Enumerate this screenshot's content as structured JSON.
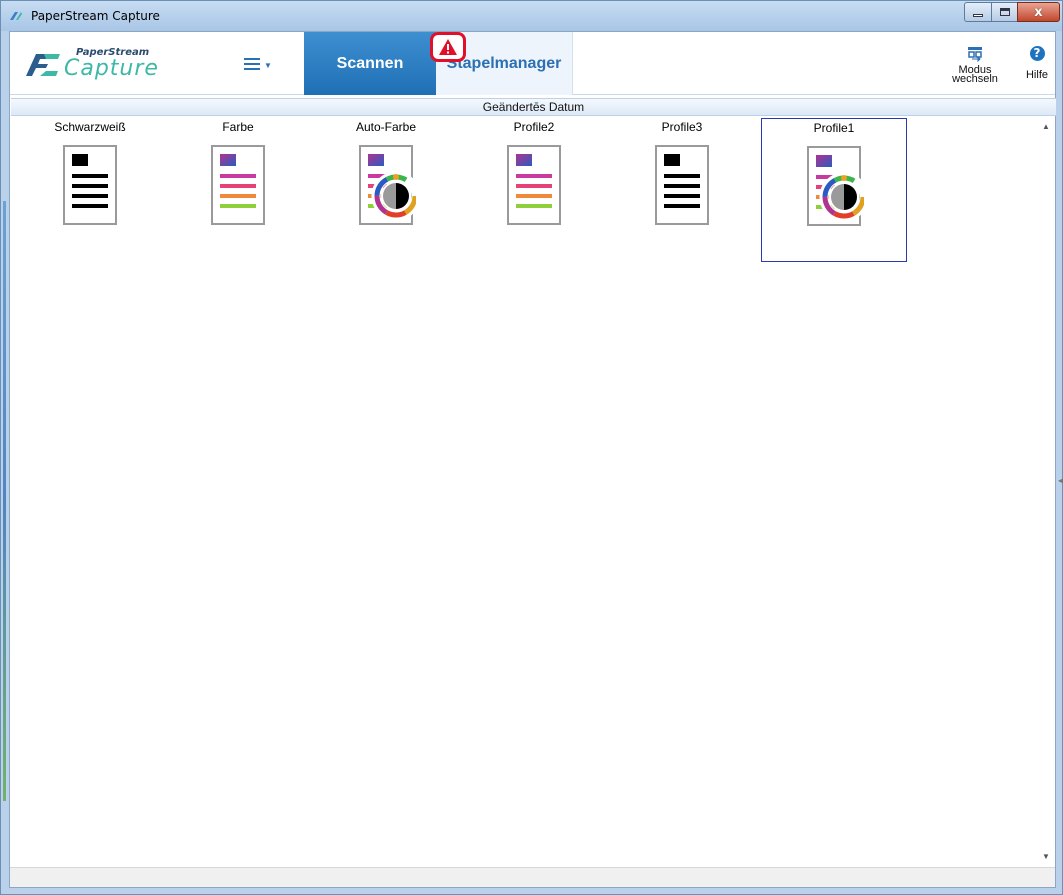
{
  "window": {
    "title": "PaperStream Capture",
    "controls": {
      "minimize": "",
      "maximize": "",
      "close": "x"
    }
  },
  "logo": {
    "small": "PaperStream",
    "big": "Capture"
  },
  "tabs": [
    {
      "label": "Scannen",
      "active": true
    },
    {
      "label": "Stapelmanager",
      "active": false,
      "has_warning": true
    }
  ],
  "toolbar": {
    "modus_label_line1": "Modus",
    "modus_label_line2": "wechseln",
    "help_label": "Hilfe",
    "help_glyph": "?"
  },
  "sort": {
    "label": "Geändertes Datum"
  },
  "profiles": [
    {
      "name": "Schwarzweiß",
      "icon": "bw-document-icon",
      "selected": false
    },
    {
      "name": "Farbe",
      "icon": "color-document-icon",
      "selected": false
    },
    {
      "name": "Auto-Farbe",
      "icon": "auto-color-document-icon",
      "selected": false
    },
    {
      "name": "Profile2",
      "icon": "color-document-icon",
      "selected": false
    },
    {
      "name": "Profile3",
      "icon": "bw-document-icon",
      "selected": false
    },
    {
      "name": "Profile1",
      "icon": "auto-color-document-icon",
      "selected": true
    }
  ],
  "colors": {
    "accent": "#1f6fb5",
    "warning": "#e0102a",
    "selection_border": "#2a3ab0",
    "logo_teal": "#3eb8a7"
  }
}
